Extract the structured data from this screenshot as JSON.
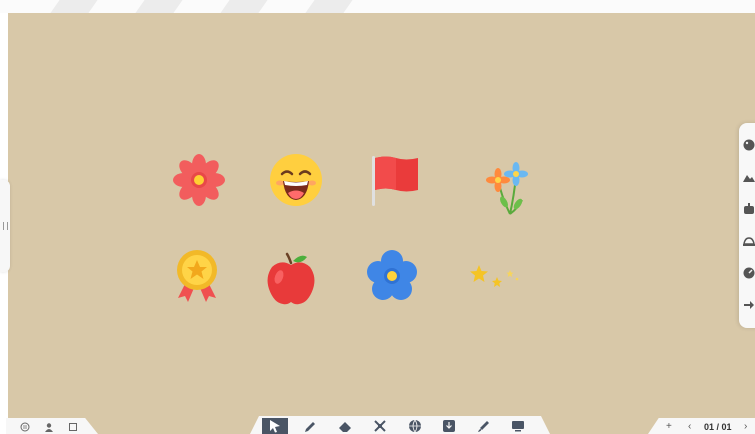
{
  "board": {
    "background": "#d8c8a8"
  },
  "stickers": [
    {
      "name": "red-flower-icon"
    },
    {
      "name": "laughing-face-icon"
    },
    {
      "name": "red-flag-icon"
    },
    {
      "name": "flower-bouquet-icon"
    },
    {
      "name": "gold-medal-icon"
    },
    {
      "name": "red-apple-icon"
    },
    {
      "name": "blue-flower-icon"
    },
    {
      "name": "sparkle-stars-icon"
    }
  ],
  "right_panel": {
    "items": [
      {
        "icon": "palette-icon"
      },
      {
        "icon": "landscape-icon"
      },
      {
        "icon": "robot-icon"
      },
      {
        "icon": "hand-icon"
      },
      {
        "icon": "gauge-icon"
      },
      {
        "icon": "arrow-icon"
      }
    ]
  },
  "bottom_left": {
    "buttons": [
      "menu-icon",
      "user-icon",
      "square-icon"
    ]
  },
  "toolbar": {
    "tools": [
      "pointer-icon",
      "pen-icon",
      "eraser-icon",
      "tools-icon",
      "globe-icon",
      "download-icon",
      "brush-icon",
      "screen-icon"
    ],
    "active_tool": "pointer-icon"
  },
  "pagination": {
    "add": "+",
    "prev": "‹",
    "page": "01 / 01",
    "next": "›"
  }
}
